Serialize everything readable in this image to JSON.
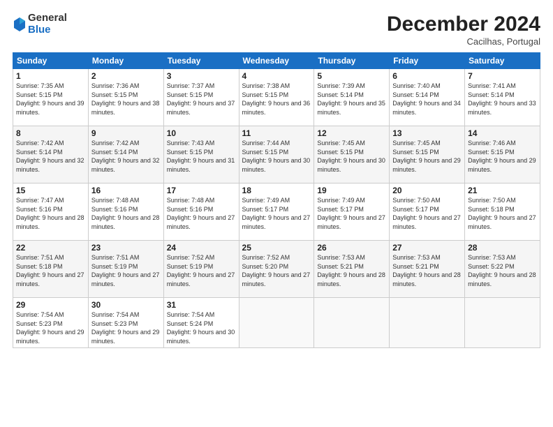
{
  "header": {
    "logo_line1": "General",
    "logo_line2": "Blue",
    "month": "December 2024",
    "location": "Cacilhas, Portugal"
  },
  "weekdays": [
    "Sunday",
    "Monday",
    "Tuesday",
    "Wednesday",
    "Thursday",
    "Friday",
    "Saturday"
  ],
  "weeks": [
    [
      {
        "day": "1",
        "sunrise": "7:35 AM",
        "sunset": "5:15 PM",
        "daylight": "9 hours and 39 minutes."
      },
      {
        "day": "2",
        "sunrise": "7:36 AM",
        "sunset": "5:15 PM",
        "daylight": "9 hours and 38 minutes."
      },
      {
        "day": "3",
        "sunrise": "7:37 AM",
        "sunset": "5:15 PM",
        "daylight": "9 hours and 37 minutes."
      },
      {
        "day": "4",
        "sunrise": "7:38 AM",
        "sunset": "5:15 PM",
        "daylight": "9 hours and 36 minutes."
      },
      {
        "day": "5",
        "sunrise": "7:39 AM",
        "sunset": "5:14 PM",
        "daylight": "9 hours and 35 minutes."
      },
      {
        "day": "6",
        "sunrise": "7:40 AM",
        "sunset": "5:14 PM",
        "daylight": "9 hours and 34 minutes."
      },
      {
        "day": "7",
        "sunrise": "7:41 AM",
        "sunset": "5:14 PM",
        "daylight": "9 hours and 33 minutes."
      }
    ],
    [
      {
        "day": "8",
        "sunrise": "7:42 AM",
        "sunset": "5:14 PM",
        "daylight": "9 hours and 32 minutes."
      },
      {
        "day": "9",
        "sunrise": "7:42 AM",
        "sunset": "5:14 PM",
        "daylight": "9 hours and 32 minutes."
      },
      {
        "day": "10",
        "sunrise": "7:43 AM",
        "sunset": "5:15 PM",
        "daylight": "9 hours and 31 minutes."
      },
      {
        "day": "11",
        "sunrise": "7:44 AM",
        "sunset": "5:15 PM",
        "daylight": "9 hours and 30 minutes."
      },
      {
        "day": "12",
        "sunrise": "7:45 AM",
        "sunset": "5:15 PM",
        "daylight": "9 hours and 30 minutes."
      },
      {
        "day": "13",
        "sunrise": "7:45 AM",
        "sunset": "5:15 PM",
        "daylight": "9 hours and 29 minutes."
      },
      {
        "day": "14",
        "sunrise": "7:46 AM",
        "sunset": "5:15 PM",
        "daylight": "9 hours and 29 minutes."
      }
    ],
    [
      {
        "day": "15",
        "sunrise": "7:47 AM",
        "sunset": "5:16 PM",
        "daylight": "9 hours and 28 minutes."
      },
      {
        "day": "16",
        "sunrise": "7:48 AM",
        "sunset": "5:16 PM",
        "daylight": "9 hours and 28 minutes."
      },
      {
        "day": "17",
        "sunrise": "7:48 AM",
        "sunset": "5:16 PM",
        "daylight": "9 hours and 27 minutes."
      },
      {
        "day": "18",
        "sunrise": "7:49 AM",
        "sunset": "5:17 PM",
        "daylight": "9 hours and 27 minutes."
      },
      {
        "day": "19",
        "sunrise": "7:49 AM",
        "sunset": "5:17 PM",
        "daylight": "9 hours and 27 minutes."
      },
      {
        "day": "20",
        "sunrise": "7:50 AM",
        "sunset": "5:17 PM",
        "daylight": "9 hours and 27 minutes."
      },
      {
        "day": "21",
        "sunrise": "7:50 AM",
        "sunset": "5:18 PM",
        "daylight": "9 hours and 27 minutes."
      }
    ],
    [
      {
        "day": "22",
        "sunrise": "7:51 AM",
        "sunset": "5:18 PM",
        "daylight": "9 hours and 27 minutes."
      },
      {
        "day": "23",
        "sunrise": "7:51 AM",
        "sunset": "5:19 PM",
        "daylight": "9 hours and 27 minutes."
      },
      {
        "day": "24",
        "sunrise": "7:52 AM",
        "sunset": "5:19 PM",
        "daylight": "9 hours and 27 minutes."
      },
      {
        "day": "25",
        "sunrise": "7:52 AM",
        "sunset": "5:20 PM",
        "daylight": "9 hours and 27 minutes."
      },
      {
        "day": "26",
        "sunrise": "7:53 AM",
        "sunset": "5:21 PM",
        "daylight": "9 hours and 28 minutes."
      },
      {
        "day": "27",
        "sunrise": "7:53 AM",
        "sunset": "5:21 PM",
        "daylight": "9 hours and 28 minutes."
      },
      {
        "day": "28",
        "sunrise": "7:53 AM",
        "sunset": "5:22 PM",
        "daylight": "9 hours and 28 minutes."
      }
    ],
    [
      {
        "day": "29",
        "sunrise": "7:54 AM",
        "sunset": "5:23 PM",
        "daylight": "9 hours and 29 minutes."
      },
      {
        "day": "30",
        "sunrise": "7:54 AM",
        "sunset": "5:23 PM",
        "daylight": "9 hours and 29 minutes."
      },
      {
        "day": "31",
        "sunrise": "7:54 AM",
        "sunset": "5:24 PM",
        "daylight": "9 hours and 30 minutes."
      },
      null,
      null,
      null,
      null
    ]
  ]
}
